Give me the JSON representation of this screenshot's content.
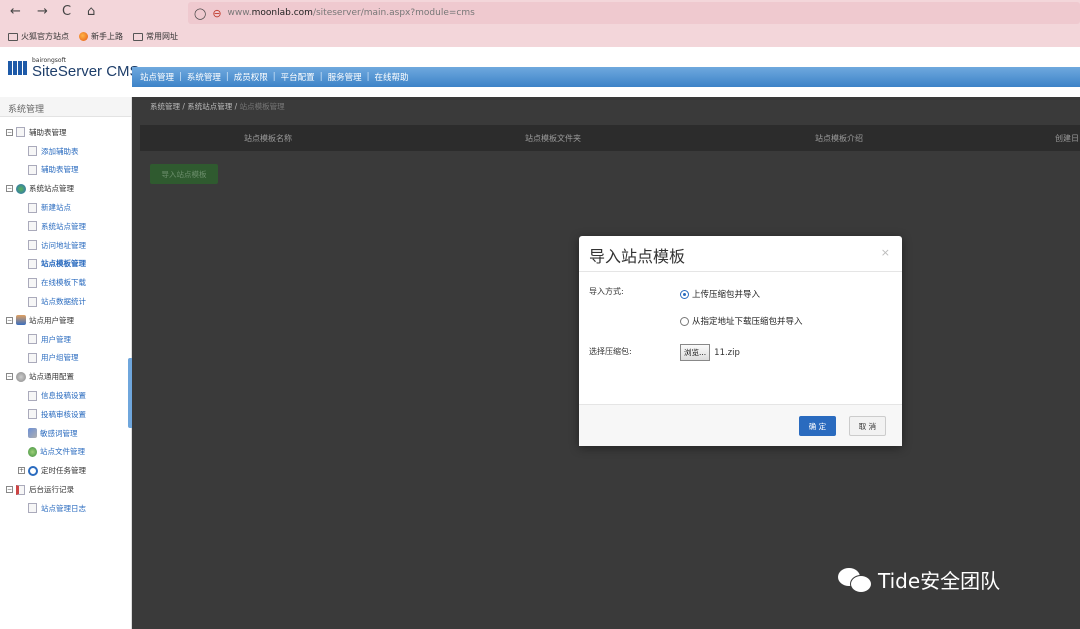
{
  "browser": {
    "back": "←",
    "forward": "→",
    "reload": "C",
    "home": "⌂",
    "url_prefix": "www.",
    "url_host": "moonlab.com",
    "url_path": "/siteserver/main.aspx?module=cms",
    "bookmarks": [
      "火狐官方站点",
      "新手上路",
      "常用网址"
    ]
  },
  "header": {
    "logo_small": "bairongsoft",
    "logo_text": "SiteServer CMS",
    "nav": [
      "站点管理",
      "系统管理",
      "成员权限",
      "平台配置",
      "服务管理",
      "在线帮助"
    ]
  },
  "sidebar": {
    "title": "系统管理",
    "groups": [
      {
        "label": "辅助表管理",
        "items": [
          "添加辅助表",
          "辅助表管理"
        ]
      },
      {
        "label": "系统站点管理",
        "items": [
          "新建站点",
          "系统站点管理",
          "访问地址管理",
          "站点模板管理",
          "在线模板下载",
          "站点数据统计"
        ]
      },
      {
        "label": "站点用户管理",
        "items": [
          "用户管理",
          "用户组管理"
        ]
      },
      {
        "label": "站点通用配置",
        "items": [
          "信息投稿设置",
          "投稿审核设置",
          "敏感词管理",
          "站点文件管理"
        ]
      },
      {
        "label": "定时任务管理",
        "items": []
      },
      {
        "label": "后台运行记录",
        "items": [
          "站点管理日志"
        ]
      }
    ]
  },
  "main": {
    "breadcrumb": [
      "系统管理",
      "系统站点管理",
      "站点模板管理"
    ],
    "columns": [
      "站点模板名称",
      "站点模板文件夹",
      "站点模板介绍",
      "创建日"
    ],
    "import_button": "导入站点模板"
  },
  "modal": {
    "title": "导入站点模板",
    "close": "×",
    "method_label": "导入方式:",
    "option_upload": "上传压缩包并导入",
    "option_download": "从指定地址下载压缩包并导入",
    "file_label": "选择压缩包:",
    "browse": "浏览...",
    "file_name": "11.zip",
    "ok": "确 定",
    "cancel": "取 消"
  },
  "watermark": "Tide安全团队"
}
